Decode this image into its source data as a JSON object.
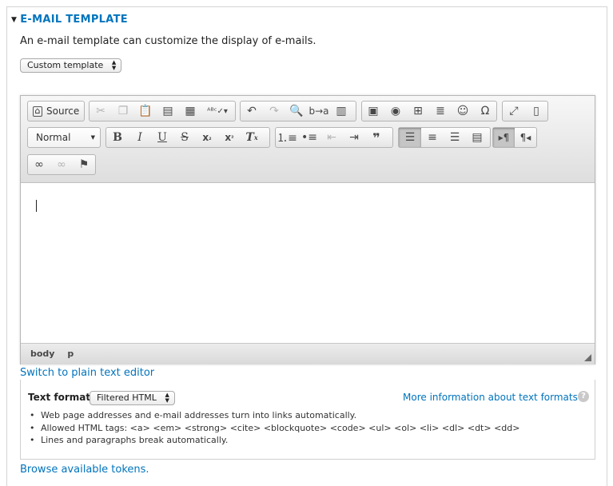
{
  "section": {
    "legend": "E-MAIL TEMPLATE",
    "description": "An e-mail template can customize the display of e-mails.",
    "template_select": "Custom template"
  },
  "toolbar": {
    "source_label": "Source",
    "format_combo": "Normal"
  },
  "editor": {
    "path": [
      "body",
      "p"
    ]
  },
  "links": {
    "switch_editor": "Switch to plain text editor",
    "more_info": "More information about text formats",
    "browse_tokens": "Browse available tokens."
  },
  "text_format": {
    "label": "Text format",
    "selected": "Filtered HTML",
    "tips": [
      "Web page addresses and e-mail addresses turn into links automatically.",
      "Allowed HTML tags: <a> <em> <strong> <cite> <blockquote> <code> <ul> <ol> <li> <dl> <dt> <dd>",
      "Lines and paragraphs break automatically."
    ]
  },
  "icons": {
    "help": "?"
  }
}
